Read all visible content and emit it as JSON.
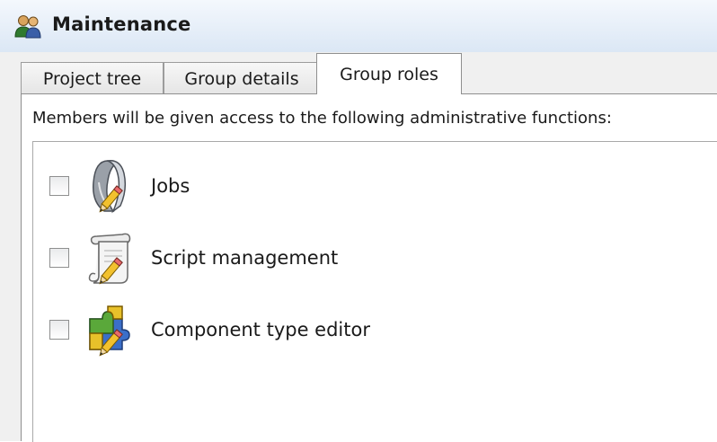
{
  "window": {
    "title": "Maintenance",
    "icon": "users-group-icon"
  },
  "tabs": [
    {
      "label": "Project tree",
      "active": false
    },
    {
      "label": "Group details",
      "active": false
    },
    {
      "label": "Group roles",
      "active": true
    }
  ],
  "group_roles": {
    "description": "Members will be given access to the following administrative functions:",
    "roles": [
      {
        "label": "Jobs",
        "checked": false,
        "icon": "jobs-edit-icon"
      },
      {
        "label": "Script management",
        "checked": false,
        "icon": "script-edit-icon"
      },
      {
        "label": "Component type editor",
        "checked": false,
        "icon": "puzzle-edit-icon"
      }
    ]
  }
}
